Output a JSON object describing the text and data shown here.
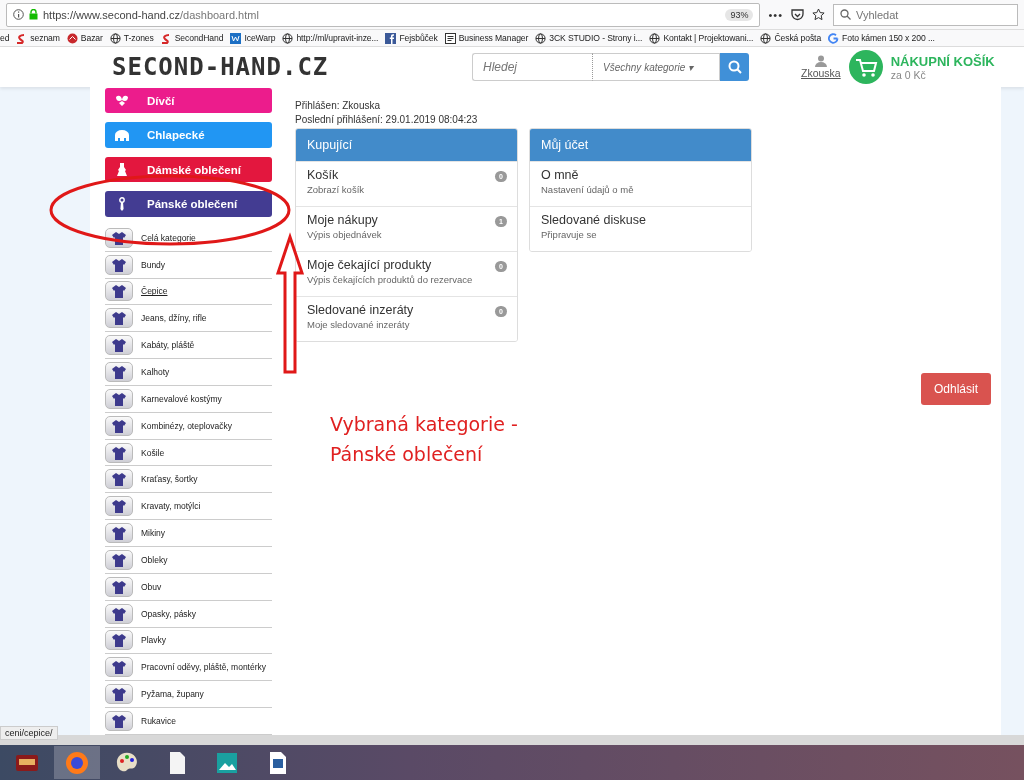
{
  "browser": {
    "url_host": "https://www.second-hand.cz",
    "url_path": "/dashboard.html",
    "zoom": "93%",
    "menu_dots": "•••",
    "search_placeholder": "Vyhledat",
    "bookmarks": [
      {
        "label": "ed"
      },
      {
        "label": "seznam"
      },
      {
        "label": "Bazar"
      },
      {
        "label": "T-zones"
      },
      {
        "label": "SecondHand"
      },
      {
        "label": "IceWarp"
      },
      {
        "label": "http://ml/upravit-inze..."
      },
      {
        "label": "Fejsbůček"
      },
      {
        "label": "Business Manager"
      },
      {
        "label": "3CK STUDIO - Strony i..."
      },
      {
        "label": "Kontakt | Projektowani..."
      },
      {
        "label": "Česká pošta"
      },
      {
        "label": "Foto kámen 150 x 200 ..."
      }
    ]
  },
  "header": {
    "logo": "SECOND-HAND.CZ",
    "search_placeholder": "Hledej",
    "category_select": "Všechny kategorie",
    "caret": "▾",
    "user": "Zkouska",
    "cart_title": "NÁKUPNÍ KOŠÍK",
    "cart_total": "za 0 Kč"
  },
  "top_categories": [
    {
      "label": "Dívčí",
      "color": "#ec1c8c"
    },
    {
      "label": "Chlapecké",
      "color": "#2196f3"
    },
    {
      "label": "Dámské oblečení",
      "color": "#e3173e"
    },
    {
      "label": "Pánské oblečení",
      "color": "#433c92"
    }
  ],
  "subcategories": [
    {
      "label": "Celá kategorie",
      "hovered": false
    },
    {
      "label": "Bundy",
      "hovered": false
    },
    {
      "label": "Čepice",
      "hovered": true
    },
    {
      "label": "Jeans, džíny, rifle",
      "hovered": false
    },
    {
      "label": "Kabáty, pláště",
      "hovered": false
    },
    {
      "label": "Kalhoty",
      "hovered": false
    },
    {
      "label": "Karnevalové kostýmy",
      "hovered": false
    },
    {
      "label": "Kombinézy, oteplovačky",
      "hovered": false
    },
    {
      "label": "Košile",
      "hovered": false
    },
    {
      "label": "Kraťasy, šortky",
      "hovered": false
    },
    {
      "label": "Kravaty, motýlci",
      "hovered": false
    },
    {
      "label": "Mikiny",
      "hovered": false
    },
    {
      "label": "Obleky",
      "hovered": false
    },
    {
      "label": "Obuv",
      "hovered": false
    },
    {
      "label": "Opasky, pásky",
      "hovered": false
    },
    {
      "label": "Plavky",
      "hovered": false
    },
    {
      "label": "Pracovní oděvy, pláště, montérky",
      "hovered": false
    },
    {
      "label": "Pyžama, župany",
      "hovered": false
    },
    {
      "label": "Rukavice",
      "hovered": false
    }
  ],
  "login": {
    "user_line": "Přihlášen: Zkouska",
    "last_login": "Poslední přihlášení: 29.01.2019 08:04:23"
  },
  "panels": [
    {
      "title": "Kupující",
      "rows": [
        {
          "title": "Košík",
          "subtitle": "Zobrazí košík",
          "count": "0"
        },
        {
          "title": "Moje nákupy",
          "subtitle": "Výpis objednávek",
          "count": "1"
        },
        {
          "title": "Moje čekající produkty",
          "subtitle": "Výpis čekajících produktů do rezervace",
          "count": "0"
        },
        {
          "title": "Sledované inzeráty",
          "subtitle": "Moje sledované inzeráty",
          "count": "0"
        }
      ]
    },
    {
      "title": "Můj účet",
      "rows": [
        {
          "title": "O mně",
          "subtitle": "Nastavení údajů o mě"
        },
        {
          "title": "Sledované diskuse",
          "subtitle": "Připravuje se"
        }
      ]
    }
  ],
  "logout_button": "Odhlásit",
  "annotation": {
    "lines": [
      "Vybraná kategorie -",
      "Pánské oblečení"
    ]
  },
  "status_link": "ceni/cepice/",
  "taskbar": [
    {
      "selected": false
    },
    {
      "selected": true
    },
    {
      "selected": false
    },
    {
      "selected": false
    },
    {
      "selected": false
    },
    {
      "selected": false
    }
  ]
}
